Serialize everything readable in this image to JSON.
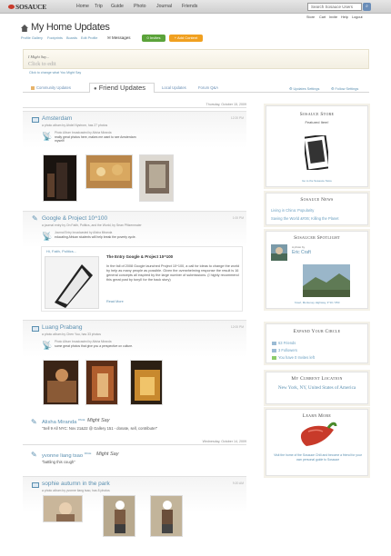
{
  "brand": {
    "name": "SOSAUCE"
  },
  "nav": [
    "Home",
    "Trip",
    "Guide",
    "Photo",
    "Journal",
    "Friends"
  ],
  "search": {
    "placeholder": "Search Sosauce Users"
  },
  "utility": [
    "Store",
    "Cart",
    "Invite",
    "Help",
    "Logout"
  ],
  "header": {
    "title": "My Home Updates",
    "links": [
      "Profile Gallery",
      "Footprints",
      "Boards",
      "Edit Profile"
    ],
    "messages": "Messages",
    "invites": "0 Invites",
    "add_content": "+ Add Content"
  },
  "status": {
    "name": "I Might Say...",
    "prompt": "Click to edit",
    "link": "Click to change what You Might Say"
  },
  "tabs": {
    "community": "Community Updates",
    "friend": "Friend Updates",
    "local": "Local Updates",
    "forum": "Forum Q&A",
    "updates_settings": "Updates Settings",
    "follow_settings": "Follow Settings"
  },
  "feed": {
    "date1": "Thursday, October 15, 2009",
    "date2": "Wednesday, October 14, 2009",
    "items": [
      {
        "title": "Amsterdam",
        "sub": "a photo album by Ahdel Nystrom, has 27 photos",
        "time": "12:20 PM",
        "bubble": "Photo Album broadcasted by Alisha Miranda",
        "comment1": "really great photos here, makes me want to see Amsterdam",
        "comment2": "myself!"
      },
      {
        "title": "Google & Project 10^100",
        "sub": "a journal entry by On Faith, Politics, and the World, by Sean Pfitzenmaier",
        "time": "1:00 PM",
        "bubble": "Journal Entry broadcasted by Alisha Miranda",
        "comment1": "educating African students will help break the poverty cycle.",
        "inner_title": "The Entry Google & Project 10^100",
        "inner_card": "Hi, Faith, Politics...",
        "inner_body": "In the fall of 2008 Google launched Project 10^100, a call for ideas to change the world by help as many people as possible. Given the overwhelming response the result is 16 general concepts all inspired by the large number of submissions. (I highly recommend this great post by tonyII for the back story)",
        "read_more": "Read More"
      },
      {
        "title": "Luang Prabang",
        "sub": "a photo album by Chen Yuu, has 33 photos",
        "time": "12:00 PM",
        "bubble": "Photo Album broadcasted by Alisha Miranda",
        "comment1": "some great photos that give you a perspective on culture."
      }
    ],
    "status1": {
      "who": "Alisha Miranda",
      "tag": "PAGE",
      "says": "Might Say",
      "body": "\"Sell 9 All NYC: Nov 21&22 @ Gallery 151 - donate, sell, contribute!\""
    },
    "status2": {
      "who": "yvonne liang tsao",
      "tag": "PAGE",
      "says": "Might Say",
      "body": "\"battling this cough\""
    },
    "last": {
      "title": "sophie autumn in the park",
      "sub": "a photo album by yvonne liang tsao, has 8 photos",
      "time": "9:20 AM"
    }
  },
  "sidebar": {
    "store": {
      "heading": "Sosauce Store",
      "featured": "Featured Item!",
      "caption": "Go to the Sosauce Store"
    },
    "news": {
      "heading": "Sosauce News",
      "items": [
        "Living in China: Popularity",
        "Saving the World &#36; Killing the Planet"
      ]
    },
    "spotlight": {
      "heading": "Sosaucer Spotlight",
      "by": "A photo by",
      "name": "Eric Craft",
      "caption": "Yosef, Monteney Highway, 3°10 / 050"
    },
    "circle": {
      "heading": "Expand Your Circle",
      "items": [
        "63 Friends",
        "3 Followers",
        "You have 0 Invites left"
      ]
    },
    "location": {
      "heading": "My Current Location",
      "value": "New York, NY, United States of America"
    },
    "learn": {
      "heading": "Learn More",
      "caption": "Visit the home of the Sosauce Chili and become a friend for your own personal guide to Sosauce"
    }
  },
  "colors": {
    "accent": "#5a8fb0",
    "green": "#5ba33a",
    "orange": "#f0a020",
    "chili": "#c83a2a"
  }
}
